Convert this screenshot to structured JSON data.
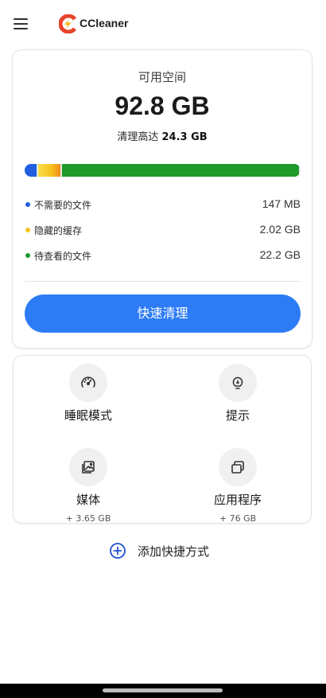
{
  "app": {
    "brand": "CCleaner"
  },
  "storage": {
    "label": "可用空间",
    "available": "92.8 GB",
    "clean_prefix": "清理高达",
    "clean_amount": "24.3 GB",
    "usage_segments": [
      {
        "name": "不需要的文件",
        "fraction": 0.05,
        "color": "#1f5fe0"
      },
      {
        "name": "隐藏的缓存",
        "fraction": 0.085,
        "color": "#f6c21c"
      },
      {
        "name": "待查看的文件",
        "fraction": 0.865,
        "color": "#1f9a2b"
      }
    ],
    "legend": [
      {
        "name": "不需要的文件",
        "size": "147 MB",
        "color": "#1f5fe0"
      },
      {
        "name": "隐藏的缓存",
        "size": "2.02 GB",
        "color": "#f6c21c"
      },
      {
        "name": "待查看的文件",
        "size": "22.2 GB",
        "color": "#1f9a2b"
      }
    ],
    "quick_clean": "快速清理"
  },
  "tiles": {
    "sleep": {
      "title": "睡眠模式",
      "icon": "speedometer-icon"
    },
    "tips": {
      "title": "提示",
      "icon": "lightbulb-icon"
    },
    "media": {
      "title": "媒体",
      "sub": "+ 3.65 GB",
      "icon": "image-gallery-icon"
    },
    "apps": {
      "title": "应用程序",
      "sub": "+ 76 GB",
      "icon": "app-stack-icon"
    }
  },
  "add_shortcut": {
    "label": "添加快捷方式",
    "icon": "plus-circle-icon",
    "color": "#1e4fd6"
  }
}
